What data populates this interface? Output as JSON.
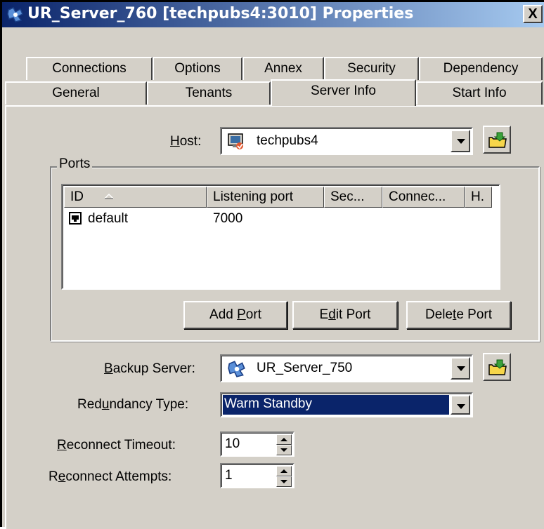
{
  "window": {
    "title": "UR_Server_760 [techpubs4:3010] Properties",
    "close_label": "X"
  },
  "tabs": {
    "row1": [
      "Connections",
      "Options",
      "Annex",
      "Security",
      "Dependency"
    ],
    "row2": [
      "General",
      "Tenants",
      "Server Info",
      "Start Info"
    ],
    "active": "Server Info"
  },
  "host": {
    "label_pre": "",
    "label_u": "H",
    "label_post": "ost:",
    "value": "techpubs4"
  },
  "ports": {
    "group_label": "Ports",
    "columns": [
      "ID",
      "Listening port",
      "Sec...",
      "Connec...",
      "H."
    ],
    "rows": [
      {
        "id": "default",
        "listening_port": "7000",
        "sec": "",
        "connec": "",
        "h": ""
      }
    ],
    "buttons": {
      "add": {
        "pre": "Add ",
        "u": "P",
        "post": "ort"
      },
      "edit": {
        "pre": "E",
        "u": "d",
        "post": "it Port"
      },
      "delete": {
        "pre": "Dele",
        "u": "t",
        "post": "e Port"
      }
    }
  },
  "backup_server": {
    "label_pre": "",
    "label_u": "B",
    "label_post": "ackup Server:",
    "value": "UR_Server_750"
  },
  "redundancy_type": {
    "label_pre": "Red",
    "label_u": "u",
    "label_post": "ndancy Type:",
    "value": "Warm Standby"
  },
  "reconnect_timeout": {
    "label_pre": "",
    "label_u": "R",
    "label_post": "econnect Timeout:",
    "value": "10"
  },
  "reconnect_attempts": {
    "label_pre": "R",
    "label_u": "e",
    "label_post": "connect Attempts:",
    "value": "1"
  },
  "colors": {
    "title_gradient_start": "#0a246a",
    "title_gradient_end": "#a6caf0",
    "selection": "#0a246a",
    "face": "#d4d0c8"
  },
  "icons": {
    "title": "server-icon",
    "host": "host-computer-icon",
    "port": "port-icon",
    "backup": "server-icon",
    "browse": "folder-browse-icon"
  }
}
